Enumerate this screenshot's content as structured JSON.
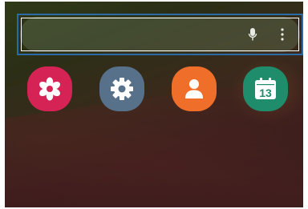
{
  "search_bar": {
    "placeholder_text": "",
    "mic_icon": "microphone-icon",
    "more_icon": "more-vert-icon"
  },
  "apps": [
    {
      "id": "blossom",
      "label": "",
      "icon": "flower-icon",
      "color": "#d42354"
    },
    {
      "id": "settings",
      "label": "",
      "icon": "gear-icon",
      "color": "#58718a"
    },
    {
      "id": "contacts",
      "label": "",
      "icon": "person-icon",
      "color": "#ef6f2a"
    },
    {
      "id": "calendar",
      "label": "",
      "icon": "calendar-icon",
      "color": "#1f8c6b",
      "day": "13"
    }
  ],
  "colors": {
    "highlight_border": "#2a6aa6",
    "search_bar_bg": "#5f6e50"
  }
}
